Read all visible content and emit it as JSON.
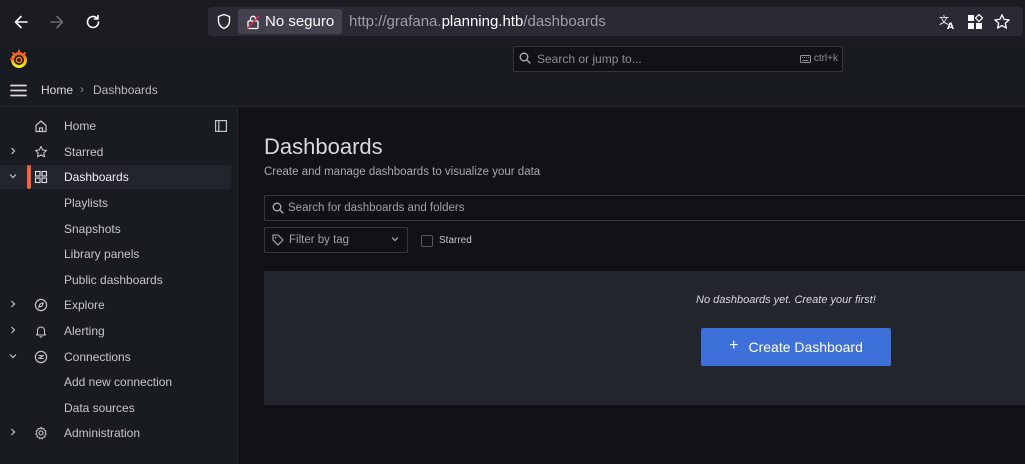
{
  "browser": {
    "insecure_label": "No seguro",
    "url_prefix": "http://grafana.",
    "url_host": "planning.htb",
    "url_path": "/dashboards"
  },
  "topbar": {
    "search_placeholder": "Search or jump to...",
    "shortcut": "ctrl+k"
  },
  "breadcrumb": {
    "home": "Home",
    "separator": "›",
    "current": "Dashboards"
  },
  "sidebar": {
    "items": [
      {
        "label": "Home",
        "icon": "home-icon"
      },
      {
        "label": "Starred",
        "icon": "star-icon"
      },
      {
        "label": "Dashboards",
        "icon": "apps-icon"
      },
      {
        "label": "Playlists"
      },
      {
        "label": "Snapshots"
      },
      {
        "label": "Library panels"
      },
      {
        "label": "Public dashboards"
      },
      {
        "label": "Explore",
        "icon": "compass-icon"
      },
      {
        "label": "Alerting",
        "icon": "bell-icon"
      },
      {
        "label": "Connections",
        "icon": "link-icon"
      },
      {
        "label": "Add new connection"
      },
      {
        "label": "Data sources"
      },
      {
        "label": "Administration",
        "icon": "cog-icon"
      }
    ]
  },
  "main": {
    "title": "Dashboards",
    "subtitle": "Create and manage dashboards to visualize your data",
    "search_placeholder": "Search for dashboards and folders",
    "tag_filter_placeholder": "Filter by tag",
    "starred_label": "Starred",
    "empty_message": "No dashboards yet. Create your first!",
    "create_button_plus": "+",
    "create_button_label": "Create Dashboard"
  },
  "colors": {
    "accent": "#3d71d9",
    "active_bar": "#f55f3e",
    "background": "#111217"
  }
}
